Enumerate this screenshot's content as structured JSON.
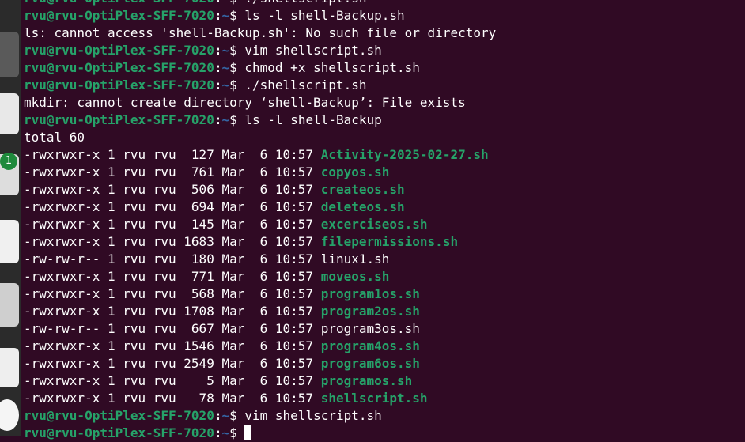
{
  "dock": {
    "badge_count": "1",
    "items": [
      {
        "name": "dock-app-icon",
        "color": "#5a5a5a"
      },
      {
        "name": "dock-app-icon",
        "color": "#e8e8e8"
      },
      {
        "name": "dock-app-icon",
        "color": "#dddddd"
      },
      {
        "name": "dock-app-icon",
        "color": "#f0f0f0"
      },
      {
        "name": "dock-app-icon",
        "color": "#cfcfcf"
      },
      {
        "name": "dock-app-icon",
        "color": "#eeeeee"
      }
    ]
  },
  "colors": {
    "background": "#300a24",
    "prompt_user": "#26a269",
    "prompt_path": "#3465a4",
    "text": "#ffffff",
    "exec_file": "#26a269"
  },
  "terminal": {
    "prompt_user": "rvu@rvu-OptiPlex-SFF-7020",
    "prompt_sep": ":",
    "prompt_path": "~",
    "prompt_symbol": "$",
    "lines": [
      {
        "type": "prompt",
        "cmd": " ./shellscript.sh"
      },
      {
        "type": "prompt",
        "cmd": " ls -l shell-Backup.sh"
      },
      {
        "type": "text",
        "text": "ls: cannot access 'shell-Backup.sh': No such file or directory"
      },
      {
        "type": "prompt",
        "cmd": " vim shellscript.sh"
      },
      {
        "type": "prompt",
        "cmd": " chmod +x shellscript.sh"
      },
      {
        "type": "prompt",
        "cmd": " ./shellscript.sh"
      },
      {
        "type": "text",
        "text": "mkdir: cannot create directory ‘shell-Backup’: File exists"
      },
      {
        "type": "prompt",
        "cmd": " ls -l shell-Backup"
      },
      {
        "type": "text",
        "text": "total 60"
      },
      {
        "type": "file",
        "meta": "-rwxrwxr-x 1 rvu rvu  127 Mar  6 10:57 ",
        "name": "Activity-2025-02-27.sh",
        "exec": true
      },
      {
        "type": "file",
        "meta": "-rwxrwxr-x 1 rvu rvu  761 Mar  6 10:57 ",
        "name": "copyos.sh",
        "exec": true
      },
      {
        "type": "file",
        "meta": "-rwxrwxr-x 1 rvu rvu  506 Mar  6 10:57 ",
        "name": "createos.sh",
        "exec": true
      },
      {
        "type": "file",
        "meta": "-rwxrwxr-x 1 rvu rvu  694 Mar  6 10:57 ",
        "name": "deleteos.sh",
        "exec": true
      },
      {
        "type": "file",
        "meta": "-rwxrwxr-x 1 rvu rvu  145 Mar  6 10:57 ",
        "name": "excerciseos.sh",
        "exec": true
      },
      {
        "type": "file",
        "meta": "-rwxrwxr-x 1 rvu rvu 1683 Mar  6 10:57 ",
        "name": "filepermissions.sh",
        "exec": true
      },
      {
        "type": "file",
        "meta": "-rw-rw-r-- 1 rvu rvu  180 Mar  6 10:57 ",
        "name": "linux1.sh",
        "exec": false
      },
      {
        "type": "file",
        "meta": "-rwxrwxr-x 1 rvu rvu  771 Mar  6 10:57 ",
        "name": "moveos.sh",
        "exec": true
      },
      {
        "type": "file",
        "meta": "-rwxrwxr-x 1 rvu rvu  568 Mar  6 10:57 ",
        "name": "program1os.sh",
        "exec": true
      },
      {
        "type": "file",
        "meta": "-rwxrwxr-x 1 rvu rvu 1708 Mar  6 10:57 ",
        "name": "program2os.sh",
        "exec": true
      },
      {
        "type": "file",
        "meta": "-rw-rw-r-- 1 rvu rvu  667 Mar  6 10:57 ",
        "name": "program3os.sh",
        "exec": false
      },
      {
        "type": "file",
        "meta": "-rwxrwxr-x 1 rvu rvu 1546 Mar  6 10:57 ",
        "name": "program4os.sh",
        "exec": true
      },
      {
        "type": "file",
        "meta": "-rwxrwxr-x 1 rvu rvu 2549 Mar  6 10:57 ",
        "name": "program6os.sh",
        "exec": true
      },
      {
        "type": "file",
        "meta": "-rwxrwxr-x 1 rvu rvu    5 Mar  6 10:57 ",
        "name": "programos.sh",
        "exec": true
      },
      {
        "type": "file",
        "meta": "-rwxrwxr-x 1 rvu rvu   78 Mar  6 10:57 ",
        "name": "shellscript.sh",
        "exec": true
      },
      {
        "type": "prompt",
        "cmd": " vim shellscript.sh"
      },
      {
        "type": "prompt",
        "cmd": " ",
        "cursor": true
      }
    ]
  }
}
